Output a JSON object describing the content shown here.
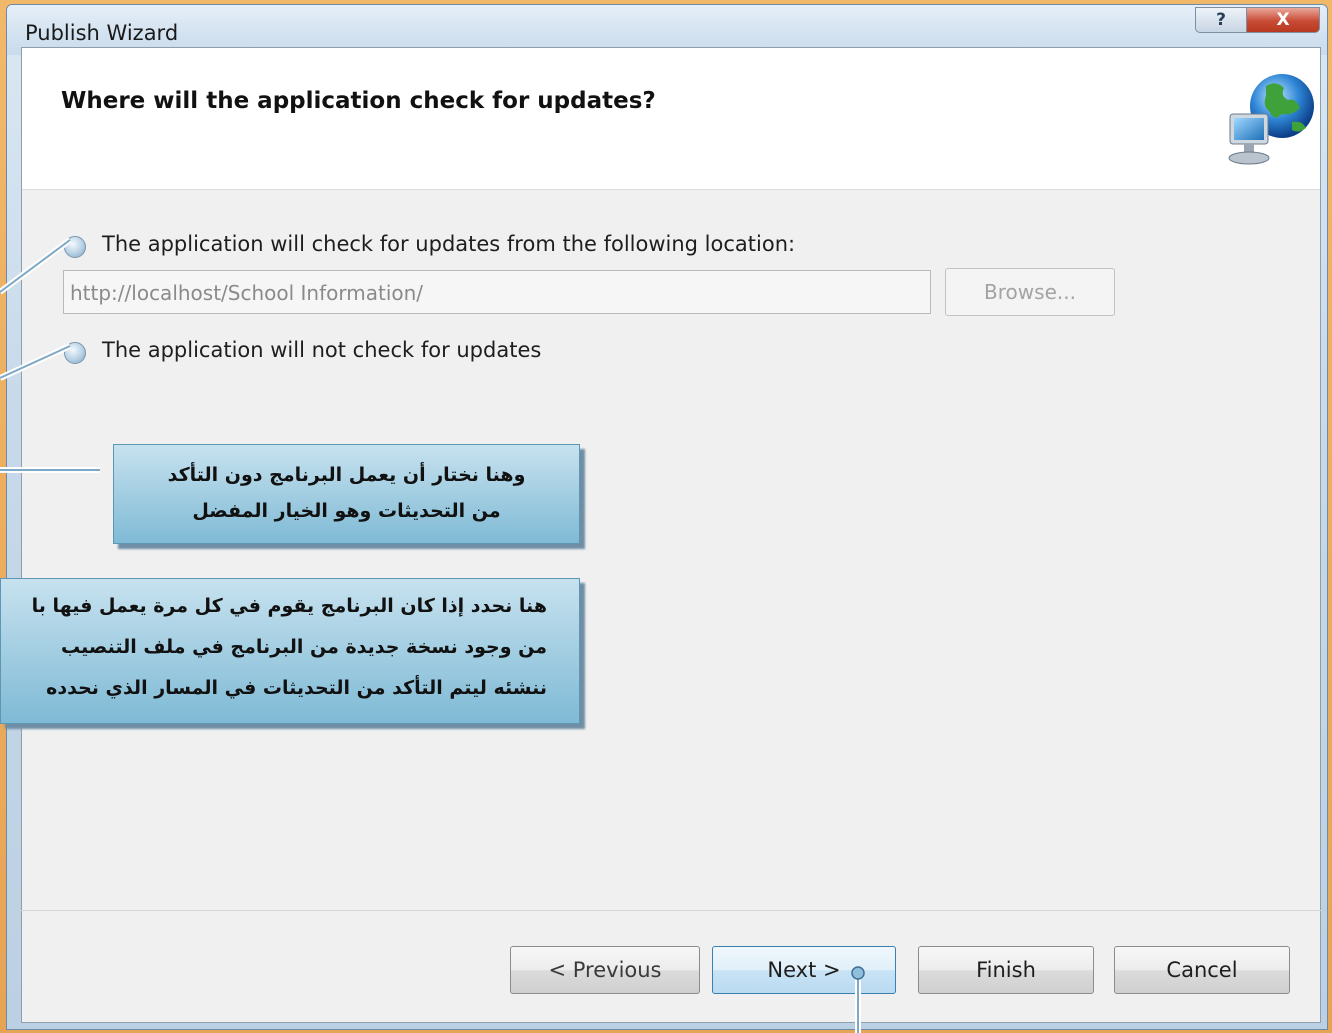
{
  "window": {
    "title": "Publish Wizard",
    "help_glyph": "?",
    "close_glyph": "X"
  },
  "header": {
    "question": "Where will the application check for updates?",
    "icon": "network-globe-icon"
  },
  "options": {
    "check_location_label": "The application will check for updates from the following location:",
    "url_value": "http://localhost/School Information/",
    "browse_label": "Browse...",
    "no_check_label": "The application will not check for updates"
  },
  "callouts": {
    "first_line1": "وهنا نختار أن يعمل البرنامج دون التأكد",
    "first_line2": "من التحديثات وهو الخيار المفضل",
    "second_line1": "هنا نحدد إذا كان البرنامج يقوم في كل مرة يعمل فيها با",
    "second_line2": "من وجود نسخة جديدة من البرنامج في ملف التنصيب",
    "second_line3": "ننشئه ليتم التأكد من التحديثات في المسار الذي نحدده"
  },
  "buttons": {
    "previous": "< Previous",
    "next": "Next >",
    "finish": "Finish",
    "cancel": "Cancel"
  },
  "colors": {
    "frame": "#e9a95a",
    "callout": "#9fcde2",
    "arrow_line": "#ffffff"
  }
}
